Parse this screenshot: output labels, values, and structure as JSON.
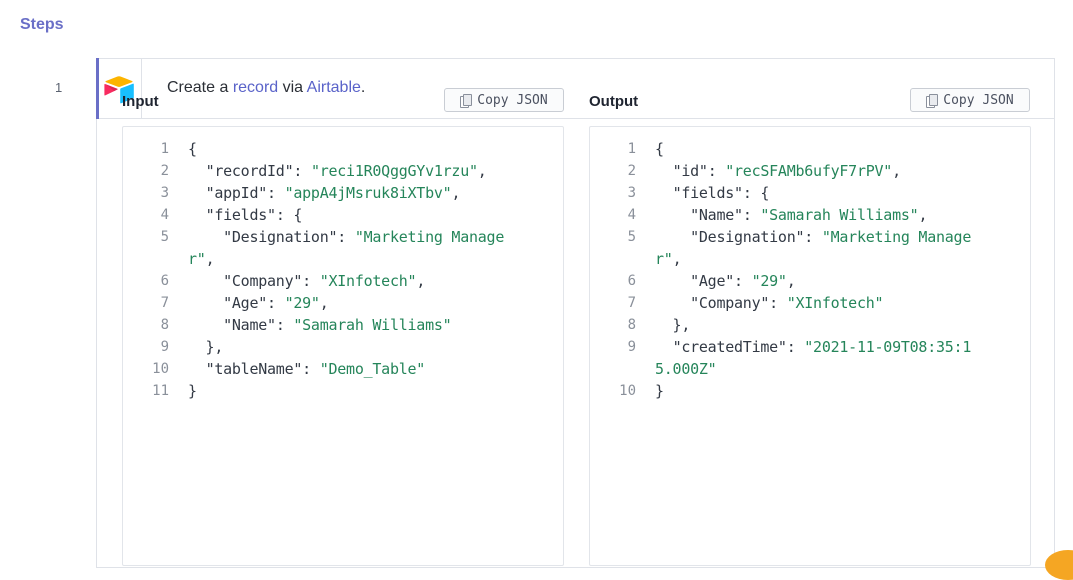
{
  "section_title": "Steps",
  "step": {
    "number": "1",
    "app_icon": "airtable-logo",
    "text_prefix": "Create a ",
    "text_object": "record",
    "text_middle": " via ",
    "text_app": "Airtable",
    "text_suffix": "."
  },
  "input_panel": {
    "title": "Input",
    "copy_label": "Copy JSON",
    "lines": [
      {
        "n": "1",
        "t": [
          [
            "p",
            "{"
          ]
        ]
      },
      {
        "n": "2",
        "t": [
          [
            "p",
            "  "
          ],
          [
            "k",
            "\"recordId\""
          ],
          [
            "p",
            ": "
          ],
          [
            "s",
            "\"reci1R0QggGYv1rzu\""
          ],
          [
            "p",
            ","
          ]
        ]
      },
      {
        "n": "3",
        "t": [
          [
            "p",
            "  "
          ],
          [
            "k",
            "\"appId\""
          ],
          [
            "p",
            ": "
          ],
          [
            "s",
            "\"appA4jMsruk8iXTbv\""
          ],
          [
            "p",
            ","
          ]
        ]
      },
      {
        "n": "4",
        "t": [
          [
            "p",
            "  "
          ],
          [
            "k",
            "\"fields\""
          ],
          [
            "p",
            ": {"
          ]
        ]
      },
      {
        "n": "5",
        "t": [
          [
            "p",
            "    "
          ],
          [
            "k",
            "\"Designation\""
          ],
          [
            "p",
            ": "
          ],
          [
            "s",
            "\"Marketing Manage"
          ]
        ]
      },
      {
        "n": "",
        "t": [
          [
            "s",
            "r\""
          ],
          [
            "p",
            ","
          ]
        ]
      },
      {
        "n": "6",
        "t": [
          [
            "p",
            "    "
          ],
          [
            "k",
            "\"Company\""
          ],
          [
            "p",
            ": "
          ],
          [
            "s",
            "\"XInfotech\""
          ],
          [
            "p",
            ","
          ]
        ]
      },
      {
        "n": "7",
        "t": [
          [
            "p",
            "    "
          ],
          [
            "k",
            "\"Age\""
          ],
          [
            "p",
            ": "
          ],
          [
            "s",
            "\"29\""
          ],
          [
            "p",
            ","
          ]
        ]
      },
      {
        "n": "8",
        "t": [
          [
            "p",
            "    "
          ],
          [
            "k",
            "\"Name\""
          ],
          [
            "p",
            ": "
          ],
          [
            "s",
            "\"Samarah Williams\""
          ]
        ]
      },
      {
        "n": "9",
        "t": [
          [
            "p",
            "  },"
          ]
        ]
      },
      {
        "n": "10",
        "t": [
          [
            "p",
            "  "
          ],
          [
            "k",
            "\"tableName\""
          ],
          [
            "p",
            ": "
          ],
          [
            "s",
            "\"Demo_Table\""
          ]
        ]
      },
      {
        "n": "11",
        "t": [
          [
            "p",
            "}"
          ]
        ]
      }
    ]
  },
  "output_panel": {
    "title": "Output",
    "copy_label": "Copy JSON",
    "lines": [
      {
        "n": "1",
        "t": [
          [
            "p",
            "{"
          ]
        ]
      },
      {
        "n": "2",
        "t": [
          [
            "p",
            "  "
          ],
          [
            "k",
            "\"id\""
          ],
          [
            "p",
            ": "
          ],
          [
            "s",
            "\"recSFAMb6ufyF7rPV\""
          ],
          [
            "p",
            ","
          ]
        ]
      },
      {
        "n": "3",
        "t": [
          [
            "p",
            "  "
          ],
          [
            "k",
            "\"fields\""
          ],
          [
            "p",
            ": {"
          ]
        ]
      },
      {
        "n": "4",
        "t": [
          [
            "p",
            "    "
          ],
          [
            "k",
            "\"Name\""
          ],
          [
            "p",
            ": "
          ],
          [
            "s",
            "\"Samarah Williams\""
          ],
          [
            "p",
            ","
          ]
        ]
      },
      {
        "n": "5",
        "t": [
          [
            "p",
            "    "
          ],
          [
            "k",
            "\"Designation\""
          ],
          [
            "p",
            ": "
          ],
          [
            "s",
            "\"Marketing Manage"
          ]
        ]
      },
      {
        "n": "",
        "t": [
          [
            "s",
            "r\""
          ],
          [
            "p",
            ","
          ]
        ]
      },
      {
        "n": "6",
        "t": [
          [
            "p",
            "    "
          ],
          [
            "k",
            "\"Age\""
          ],
          [
            "p",
            ": "
          ],
          [
            "s",
            "\"29\""
          ],
          [
            "p",
            ","
          ]
        ]
      },
      {
        "n": "7",
        "t": [
          [
            "p",
            "    "
          ],
          [
            "k",
            "\"Company\""
          ],
          [
            "p",
            ": "
          ],
          [
            "s",
            "\"XInfotech\""
          ]
        ]
      },
      {
        "n": "8",
        "t": [
          [
            "p",
            "  },"
          ]
        ]
      },
      {
        "n": "9",
        "t": [
          [
            "p",
            "  "
          ],
          [
            "k",
            "\"createdTime\""
          ],
          [
            "p",
            ": "
          ],
          [
            "s",
            "\"2021-11-09T08:35:1"
          ]
        ]
      },
      {
        "n": "",
        "t": [
          [
            "s",
            "5.000Z\""
          ]
        ]
      },
      {
        "n": "10",
        "t": [
          [
            "p",
            "}"
          ]
        ]
      }
    ]
  },
  "colors": {
    "accent": "#6a6fc7",
    "link": "#5a63c9",
    "json_string": "#25855a"
  }
}
